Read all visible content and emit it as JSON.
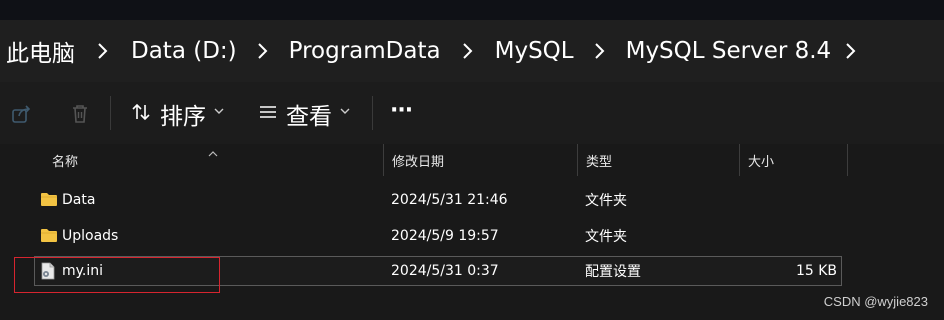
{
  "breadcrumb": [
    "此电脑",
    "Data (D:)",
    "ProgramData",
    "MySQL",
    "MySQL Server 8.4"
  ],
  "toolbar": {
    "sort_label": "排序",
    "view_label": "查看",
    "more_label": "···"
  },
  "columns": {
    "name": "名称",
    "modified": "修改日期",
    "type": "类型",
    "size": "大小"
  },
  "files": [
    {
      "name": "Data",
      "modified": "2024/5/31 21:46",
      "type": "文件夹",
      "size": "",
      "icon": "folder-icon"
    },
    {
      "name": "Uploads",
      "modified": "2024/5/9 19:57",
      "type": "文件夹",
      "size": "",
      "icon": "folder-icon"
    },
    {
      "name": "my.ini",
      "modified": "2024/5/31 0:37",
      "type": "配置设置",
      "size": "15 KB",
      "icon": "config-file-icon"
    }
  ],
  "watermark": "CSDN @wyjie823",
  "colors": {
    "folder": "#f2c343",
    "highlight": "#d6252f",
    "background": "#191919"
  }
}
